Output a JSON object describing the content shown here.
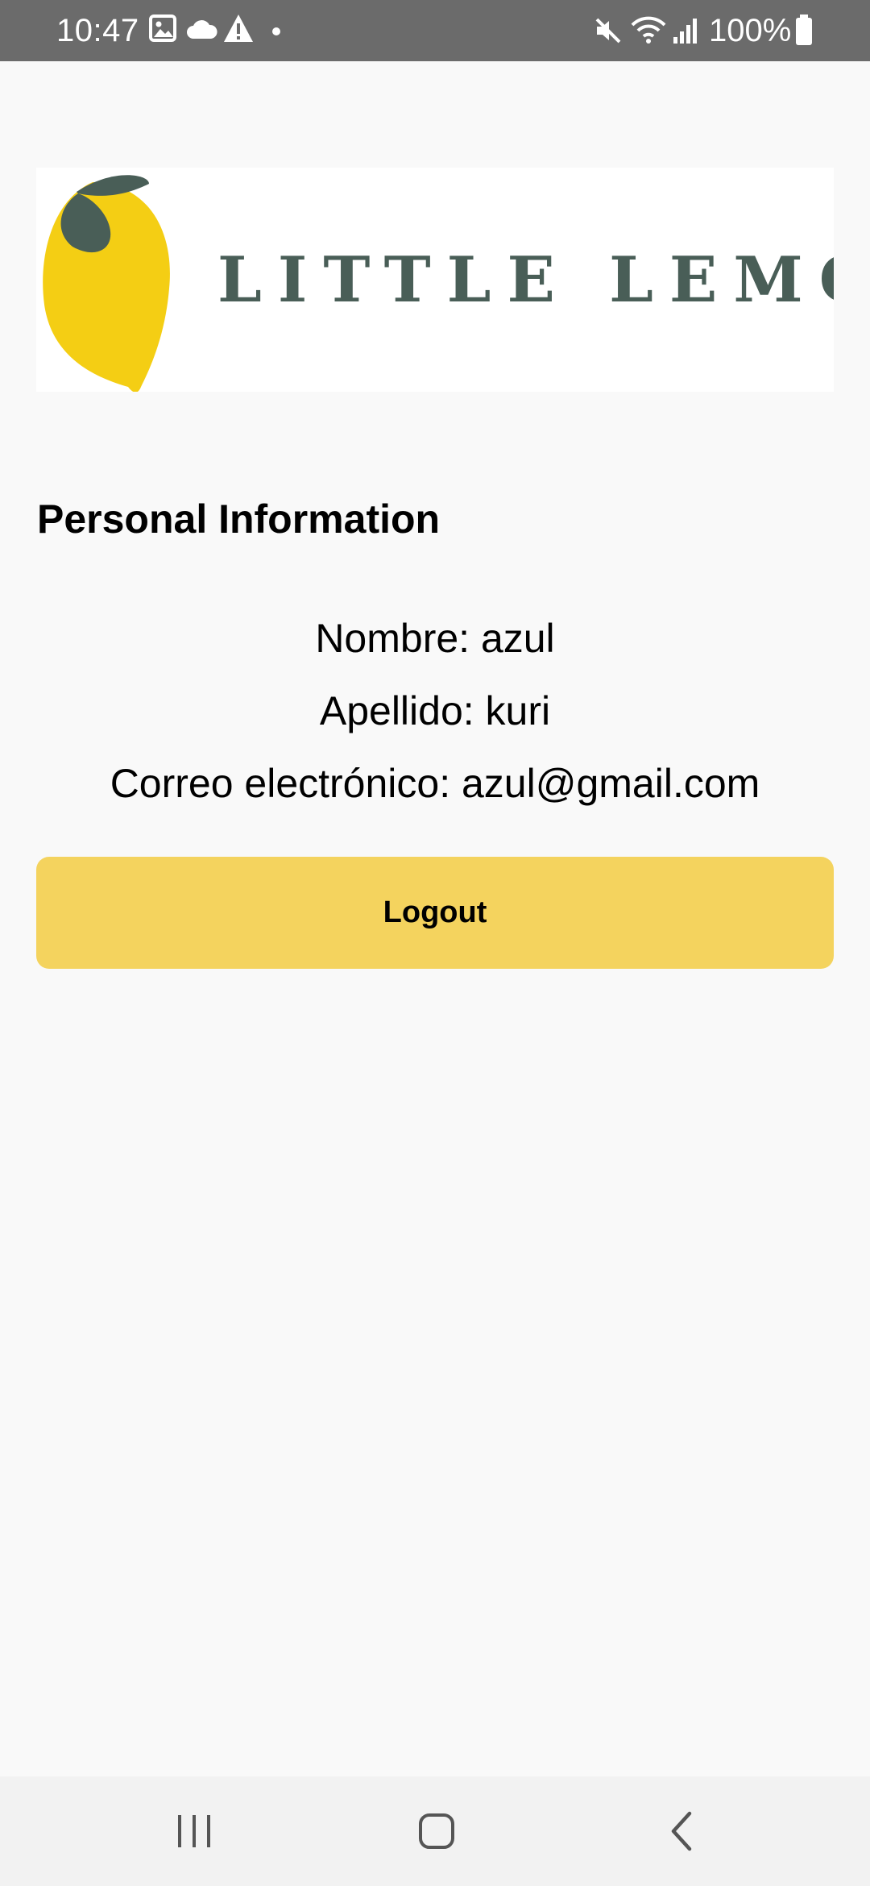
{
  "status_bar": {
    "time": "10:47",
    "battery": "100%",
    "icons_left": [
      "gallery-icon",
      "cloud-icon",
      "warning-icon",
      "dot-icon"
    ],
    "icons_right": [
      "mute-icon",
      "wifi-icon",
      "signal-icon",
      "battery-icon"
    ]
  },
  "logo": {
    "text": "LITTLE LEMON",
    "colors": {
      "lemon": "#f4ce14",
      "leaf": "#495e57",
      "text": "#495e57"
    }
  },
  "profile": {
    "section_title": "Personal Information",
    "first_name_line": "Nombre: azul",
    "last_name_line": "Apellido: kuri",
    "email_line": "Correo electrónico: azul@gmail.com"
  },
  "actions": {
    "logout_label": "Logout"
  },
  "nav": {
    "buttons": [
      "recent-apps-icon",
      "home-icon",
      "back-icon"
    ]
  },
  "colors": {
    "status_bar_bg": "#6b6b6b",
    "page_bg": "#f9f9f9",
    "button_bg": "#f4d35e",
    "nav_bg": "#f2f2f2"
  }
}
